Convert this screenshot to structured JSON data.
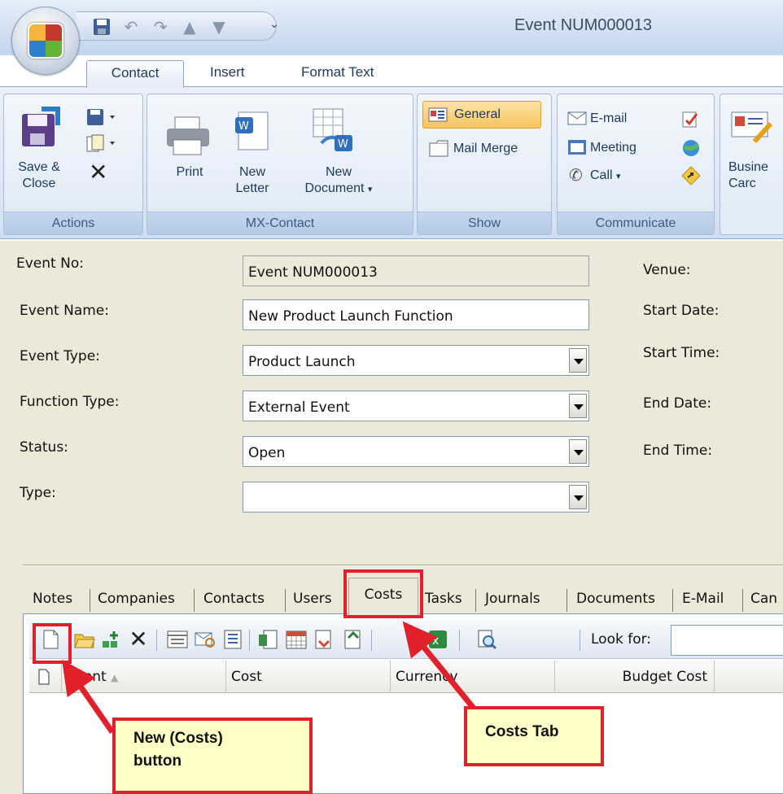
{
  "window": {
    "title": "Event NUM000013"
  },
  "ribbon_tabs": [
    "Contact",
    "Insert",
    "Format Text"
  ],
  "ribbon": {
    "actions": {
      "save_close": [
        "Save &",
        "Close"
      ],
      "label": "Actions"
    },
    "mx_contact": {
      "print": "Print",
      "new_letter": [
        "New",
        "Letter"
      ],
      "new_document": [
        "New",
        "Document"
      ],
      "label": "MX-Contact"
    },
    "show": {
      "general": "General",
      "mail_merge": "Mail Merge",
      "label": "Show"
    },
    "communicate": {
      "email": "E-mail",
      "meeting": "Meeting",
      "call": "Call",
      "label": "Communicate"
    },
    "business_card": [
      "Busine",
      "Carc"
    ]
  },
  "form": {
    "labels": {
      "event_no": "Event No:",
      "event_name": "Event Name:",
      "event_type": "Event Type:",
      "function_type": "Function Type:",
      "status": "Status:",
      "type": "Type:",
      "venue": "Venue:",
      "start_date": "Start Date:",
      "start_time": "Start Time:",
      "end_date": "End Date:",
      "end_time": "End Time:"
    },
    "values": {
      "event_no": "Event NUM000013",
      "event_name": "New Product Launch Function",
      "event_type": "Product Launch",
      "function_type": "External Event",
      "status": "Open",
      "type": ""
    }
  },
  "bottom_tabs": [
    "Notes",
    "Companies",
    "Contacts",
    "Users",
    "Costs",
    "Tasks",
    "Journals",
    "Documents",
    "E-Mail",
    "Can"
  ],
  "grid": {
    "look_for_label": "Look for:",
    "columns": [
      "Event",
      "Cost",
      "Currency",
      "Budget Cost"
    ]
  },
  "callouts": {
    "new_button": [
      "New (Costs)",
      "button"
    ],
    "costs_tab": "Costs Tab"
  },
  "colors": {
    "highlight": "#e0202a",
    "callout_bg": "#ffffc8",
    "form_bg": "#ece9d8"
  }
}
